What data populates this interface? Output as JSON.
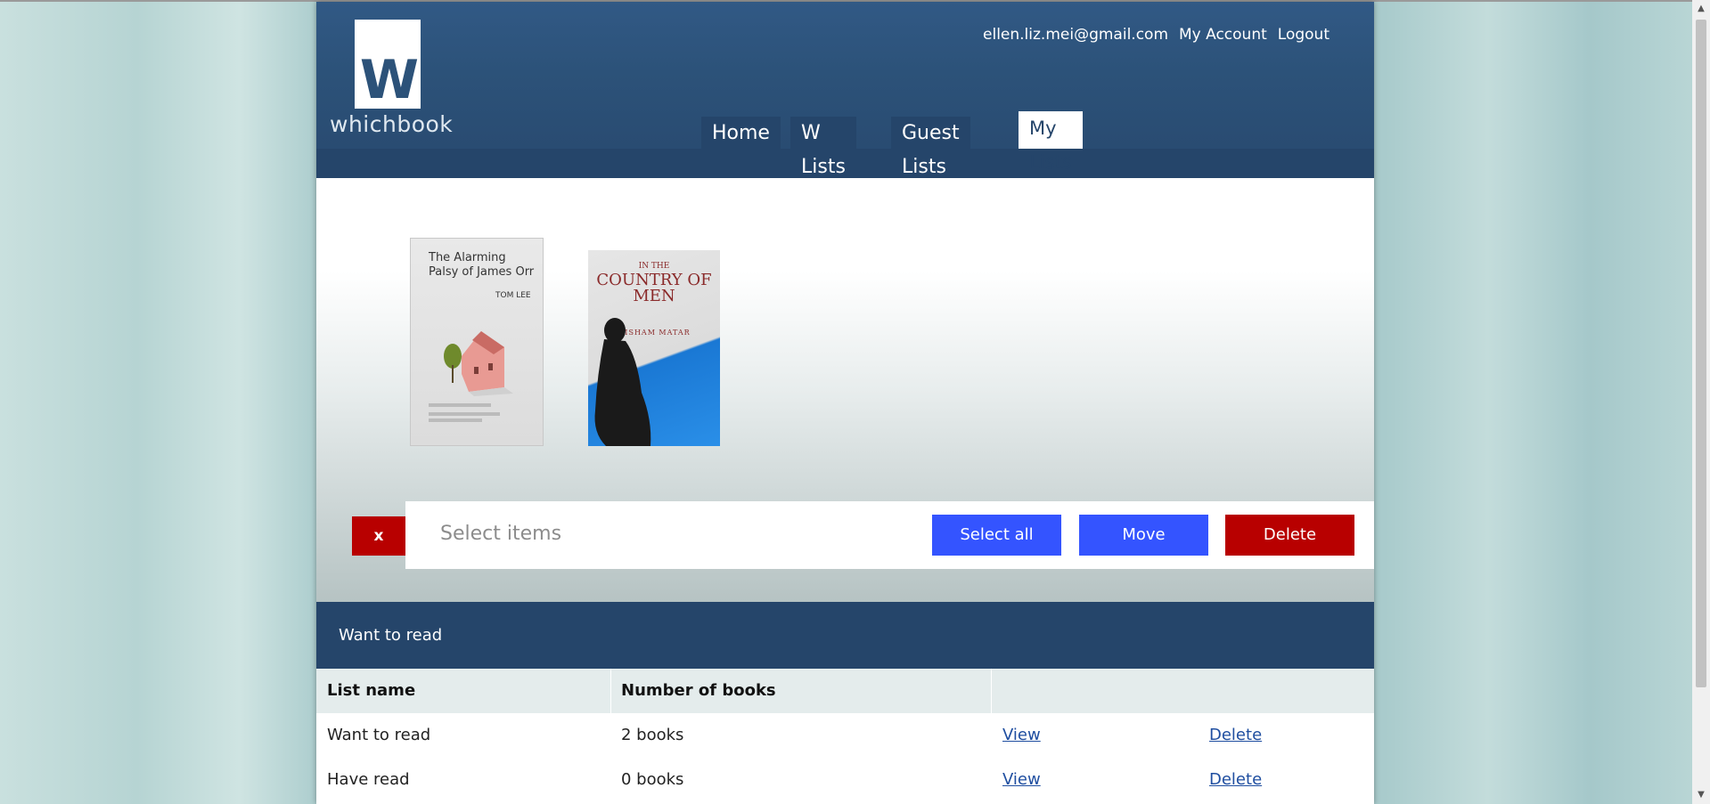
{
  "header": {
    "logo_text": "whichbook",
    "user_email": "ellen.liz.mei@gmail.com",
    "my_account": "My Account",
    "logout": "Logout"
  },
  "nav": {
    "items": [
      {
        "label": "Home"
      },
      {
        "label": "W Lists"
      },
      {
        "label": "Guest Lists"
      },
      {
        "label": "My Lists",
        "active": true
      }
    ]
  },
  "books": [
    {
      "title": "The Alarming Palsy of James Orr",
      "author": "TOM LEE"
    },
    {
      "title_top": "IN THE",
      "title_main": "COUNTRY OF MEN",
      "author": "HISHAM MATAR"
    }
  ],
  "actions": {
    "close_label": "x",
    "select_label": "Select items",
    "select_all": "Select all",
    "move": "Move",
    "delete": "Delete"
  },
  "list_section": {
    "title": "Want to read",
    "columns": [
      "List name",
      "Number of books"
    ],
    "rows": [
      {
        "name": "Want to read",
        "count": "2 books",
        "view": "View",
        "delete": "Delete"
      },
      {
        "name": "Have read",
        "count": "0 books",
        "view": "View",
        "delete": "Delete"
      }
    ]
  },
  "colors": {
    "header": "#2c5279",
    "blue_button": "#3454ff",
    "red_button": "#b80000"
  }
}
